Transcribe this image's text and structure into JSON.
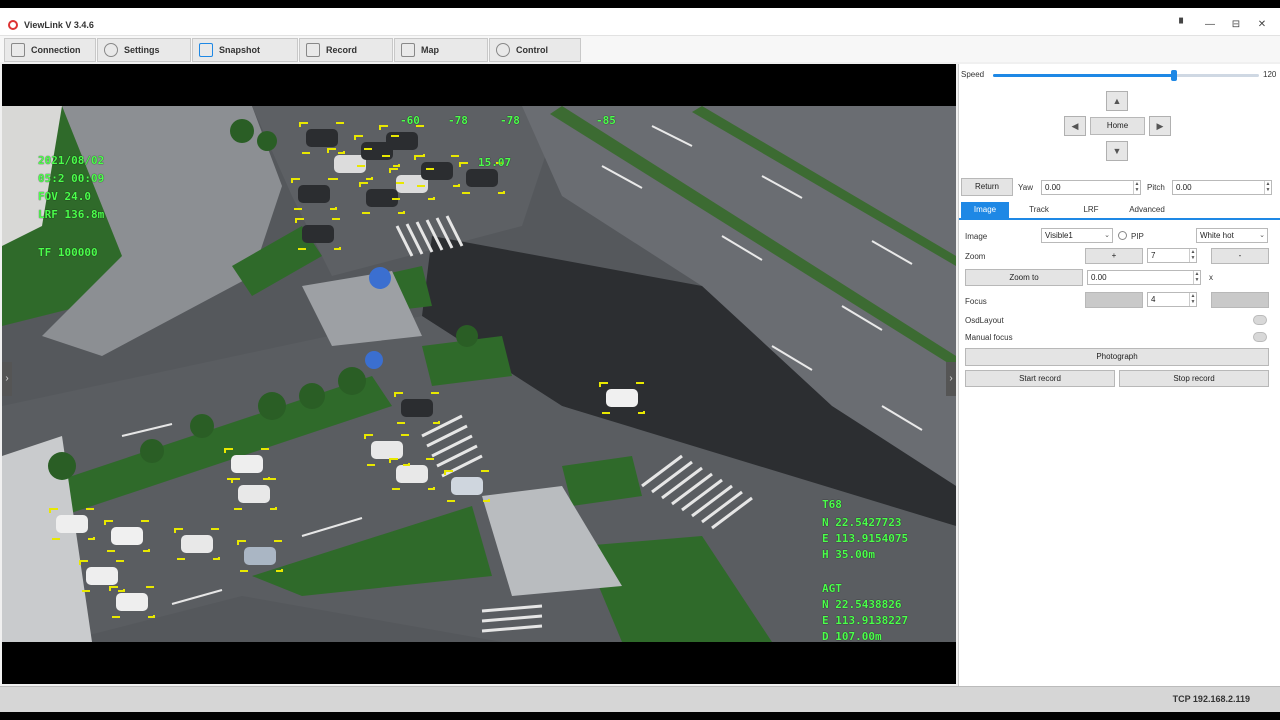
{
  "window": {
    "title": "ViewLink V 3.4.6"
  },
  "title_controls": {
    "pin": "▘",
    "minimize": "—",
    "restore": "⊟",
    "close": "✕"
  },
  "main_tabs": [
    {
      "label": "Connection",
      "icon": "link-icon"
    },
    {
      "label": "Settings",
      "icon": "gear-icon"
    },
    {
      "label": "Snapshot",
      "icon": "camera-icon"
    },
    {
      "label": "Record",
      "icon": "video-icon"
    },
    {
      "label": "Map",
      "icon": "map-icon"
    },
    {
      "label": "Control",
      "icon": "gamepad-icon"
    }
  ],
  "video": {
    "osd_top_left": [
      "2021/08/02",
      "05:2 00:09",
      "FOV 24.0",
      "LRF 136.8m",
      "TF 100000"
    ],
    "osd_top_center": [
      "-60",
      "-78",
      "-78",
      "-85"
    ],
    "osd_top_center_2": "15.07",
    "osd_bottom_right_1": [
      "T68",
      "N 22.5427723",
      "E 113.9154075",
      "H 35.00m"
    ],
    "osd_bottom_right_2": [
      "AGT",
      "N 22.5438826",
      "E 113.9138227",
      "D 107.00m"
    ],
    "left_arrow": "›",
    "right_arrow": "›"
  },
  "panel": {
    "speed": {
      "label": "Speed",
      "value_label": "120",
      "level": 0.68
    },
    "ptz": {
      "up": "▲",
      "down": "▼",
      "left": "◀",
      "right": "▶",
      "home": "Home"
    },
    "return_button": "Return",
    "yaw": {
      "label": "Yaw",
      "value": "0.00"
    },
    "pitch": {
      "label": "Pitch",
      "value": "0.00"
    },
    "sub_tabs": [
      "Image",
      "Track",
      "LRF",
      "Advanced"
    ],
    "active_sub_tab": "Image",
    "image": {
      "label": "Image",
      "source": "Visible1",
      "pip_label": "PIP",
      "palette": "White hot"
    },
    "zoom": {
      "label": "Zoom",
      "plus": "+",
      "minus": "-",
      "value": "7"
    },
    "zoom_to": {
      "button": "Zoom to",
      "value": "0.00",
      "unit": "x"
    },
    "focus": {
      "label": "Focus",
      "value": "4"
    },
    "osd_layout": {
      "label": "OsdLayout"
    },
    "manual_focus": {
      "label": "Manual focus"
    },
    "photograph_button": "Photograph",
    "start_record_button": "Start record",
    "stop_record_button": "Stop record"
  },
  "status_bar": {
    "connection": "TCP 192.168.2.119"
  },
  "colors": {
    "accent": "#1e88e5",
    "osd": "#4cff4c",
    "detection_box": "#e8e800"
  }
}
